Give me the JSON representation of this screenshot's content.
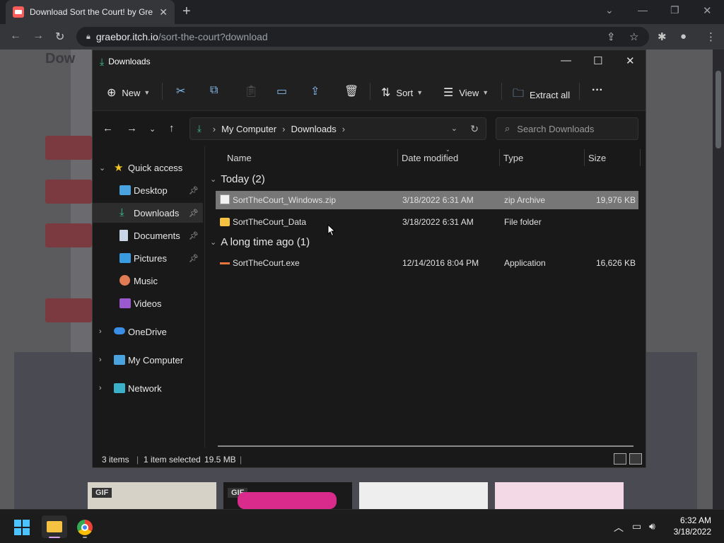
{
  "browser": {
    "tab_title": "Download Sort the Court! by Gre",
    "url_host": "graebor.itch.io",
    "url_path": "/sort-the-court?download"
  },
  "explorer": {
    "title": "Downloads",
    "commands": {
      "new": "New",
      "sort": "Sort",
      "view": "View",
      "extract_all": "Extract all"
    },
    "breadcrumb": [
      "My Computer",
      "Downloads"
    ],
    "search_placeholder": "Search Downloads",
    "nav": {
      "quick_access": "Quick access",
      "items": [
        "Desktop",
        "Downloads",
        "Documents",
        "Pictures",
        "Music",
        "Videos"
      ],
      "onedrive": "OneDrive",
      "my_computer": "My Computer",
      "network": "Network"
    },
    "columns": {
      "name": "Name",
      "date": "Date modified",
      "type": "Type",
      "size": "Size"
    },
    "groups": [
      {
        "label": "Today (2)",
        "files": [
          {
            "name": "SortTheCourt_Windows.zip",
            "date": "3/18/2022 6:31 AM",
            "type": "zip Archive",
            "size": "19,976 KB"
          },
          {
            "name": "SortTheCourt_Data",
            "date": "3/18/2022 6:31 AM",
            "type": "File folder",
            "size": ""
          }
        ]
      },
      {
        "label": "A long time ago (1)",
        "files": [
          {
            "name": "SortTheCourt.exe",
            "date": "12/14/2016 8:04 PM",
            "type": "Application",
            "size": "16,626 KB"
          }
        ]
      }
    ],
    "status": {
      "items": "3 items",
      "selected": "1 item selected",
      "size": "19.5 MB"
    }
  },
  "thumbnails": {
    "gif1": "GIF",
    "gif2": "GIF"
  },
  "taskbar": {
    "time": "6:32 AM",
    "date": "3/18/2022"
  }
}
